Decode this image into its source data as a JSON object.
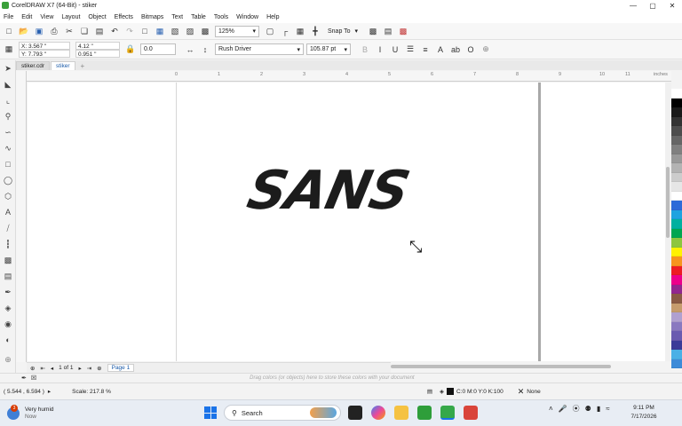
{
  "window": {
    "title": "CorelDRAW X7 (64-Bit) - stiker",
    "minimize": "—",
    "maximize": "▢",
    "close": "✕"
  },
  "menu": [
    "File",
    "Edit",
    "View",
    "Layout",
    "Object",
    "Effects",
    "Bitmaps",
    "Text",
    "Table",
    "Tools",
    "Window",
    "Help"
  ],
  "toolbar": {
    "zoom": "125%",
    "snap": "Snap To"
  },
  "propbar": {
    "x": "X: 3.567 \"",
    "y": "Y: 7.793 \"",
    "w": "4.12 \"",
    "h": "0.951 \"",
    "rotation": "0.0",
    "font": "Rush Driver",
    "size": "105.87 pt"
  },
  "tabs": [
    "stiker.cdr",
    "stiker"
  ],
  "ruler": {
    "h": [
      "0",
      "1",
      "2",
      "3",
      "4",
      "5",
      "6",
      "7",
      "8",
      "9",
      "10",
      "11"
    ],
    "unit": "inches"
  },
  "artwork_text": "SANS",
  "pagenav": {
    "count": "1 of 1",
    "tab": "Page 1"
  },
  "doc_palette_hint": "Drag colors (or objects) here to store these colors with your document",
  "status": {
    "cursor": "( 5.544 , 6.594 )",
    "scale": "Scale: 217.8 %",
    "fill": "C:0 M:0 Y:0 K:100",
    "outline": "None"
  },
  "palette": [
    "#ffffff",
    "#000000",
    "#1a1a1a",
    "#333333",
    "#4d4d4d",
    "#666666",
    "#808080",
    "#999999",
    "#b3b3b3",
    "#cccccc",
    "#e6e6e6",
    "#ffffff",
    "#2d6bd8",
    "#1fa3e0",
    "#00b0a0",
    "#00a651",
    "#8dc63f",
    "#fff200",
    "#f7941d",
    "#ed1c24",
    "#ec008c",
    "#92278f",
    "#8a5a44",
    "#c69c6d",
    "#b0a0d0",
    "#8a79c0",
    "#6a5bb0",
    "#3b3b98",
    "#4ab0e6",
    "#3d8bd8"
  ],
  "taskbar": {
    "weather": "Very humid",
    "weather_sub": "Now",
    "weather_badge": "3",
    "search": "Search",
    "time": "9:11 PM",
    "date": "7/17/2026"
  }
}
